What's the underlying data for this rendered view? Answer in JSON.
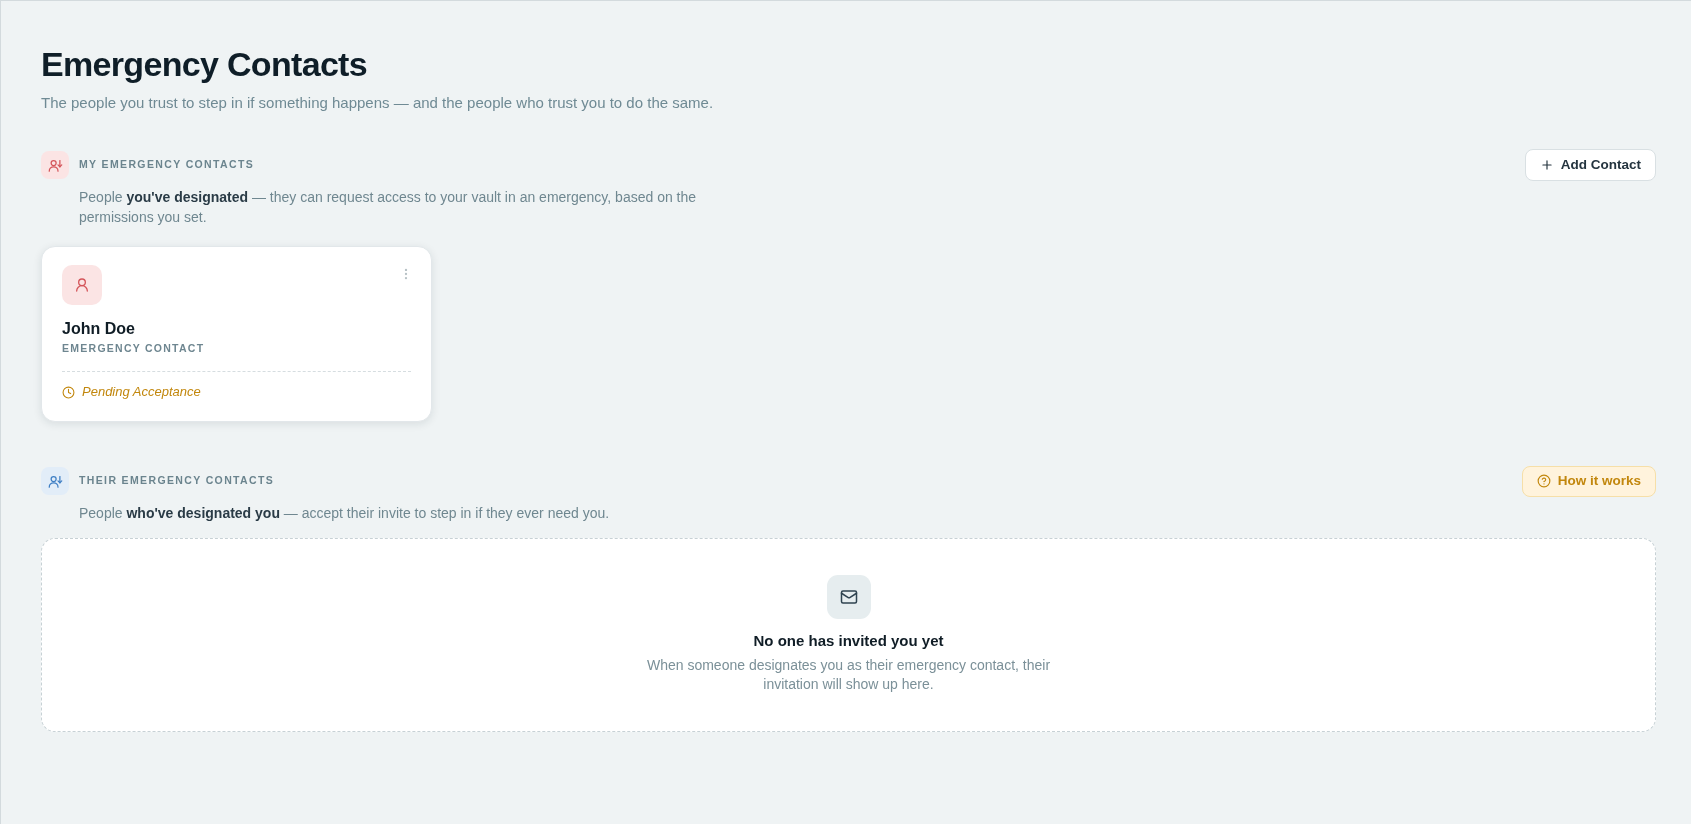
{
  "page": {
    "title": "Emergency Contacts",
    "subtitle": "The people you trust to step in if something happens — and the people who trust you to do the same."
  },
  "sections": [
    {
      "kind": "outgoing",
      "title": "MY EMERGENCY CONTACTS",
      "description": "People **you've designated** — they can request access to your vault in an emergency, based on the permissions you set.",
      "action": {
        "kind": "add",
        "label": "Add Contact"
      },
      "contacts": [
        {
          "name": "John Doe",
          "role": "EMERGENCY CONTACT",
          "status": {
            "kind": "pending",
            "label": "Pending Acceptance"
          }
        }
      ]
    },
    {
      "kind": "incoming",
      "title": "THEIR EMERGENCY CONTACTS",
      "description": "People **who've designated you** — accept their invite to step in if they ever need you.",
      "action": {
        "kind": "help",
        "label": "How it works"
      },
      "empty_state": {
        "title": "No one has invited you yet",
        "text": "When someone designates you as their emergency contact, their invitation will show up here."
      }
    }
  ]
}
